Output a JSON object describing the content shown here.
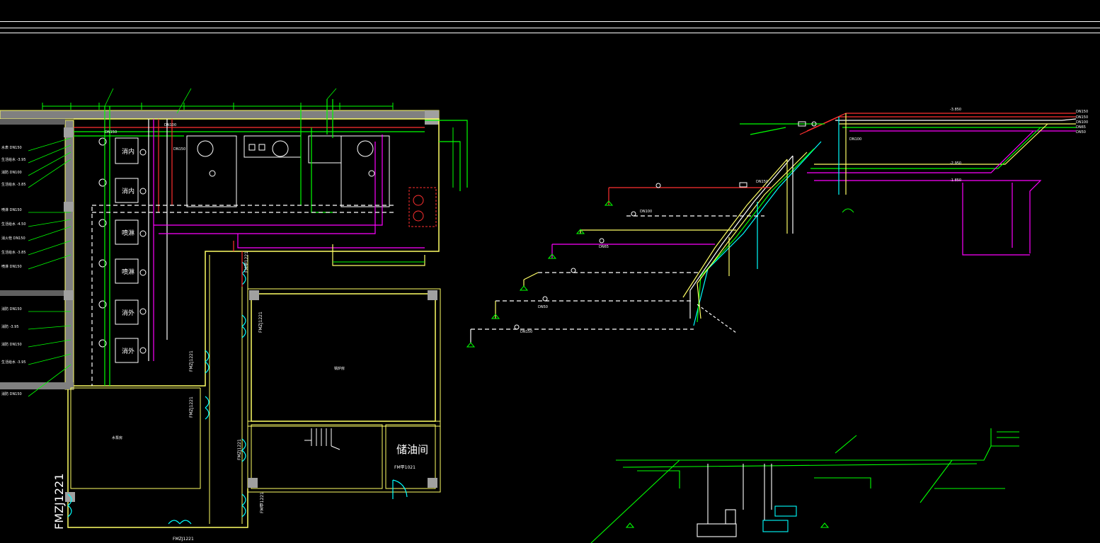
{
  "colors": {
    "background": "#000000",
    "wall": "#ffff66",
    "wall_fill": "#808080",
    "supply": "#00ff00",
    "hot": "#ff3030",
    "return": "#ff00ff",
    "aux": "#00ffff",
    "dashed": "#ffffff",
    "note": "#ffffff"
  },
  "rooms": {
    "oil_storage": "储油间",
    "central_room": "锅炉房",
    "left_room": "水泵房"
  },
  "doors": {
    "door_a": "FMZJ1221",
    "door_b": "FMZJ1221",
    "door_c": "FMZJ1221",
    "door_d": "FMZJ1221",
    "door_e": "FM甲1021",
    "door_f": "FM甲1221",
    "door_g": "FMZJ1221",
    "door_h": "FMZJ1221",
    "door_i": "FM甲1221"
  },
  "plan_tags": {
    "tag_top1": "DN100",
    "tag_top2": "DN150",
    "tag_top3": "DN150",
    "tag_ahu1": "消内",
    "tag_ahu2": "消内",
    "tag_ahu3": "喷淋",
    "tag_ahu4": "喷淋",
    "tag_ahu5": "消外",
    "tag_ahu6": "消外",
    "tag_ahu7": "生活"
  },
  "iso_tags": {
    "dn150": "DN150",
    "dn100": "DN100",
    "dn65": "DN65",
    "dn50": "DN50",
    "elev1": "-3.850",
    "elev2": "-2.950",
    "elev3": "-1.850"
  }
}
